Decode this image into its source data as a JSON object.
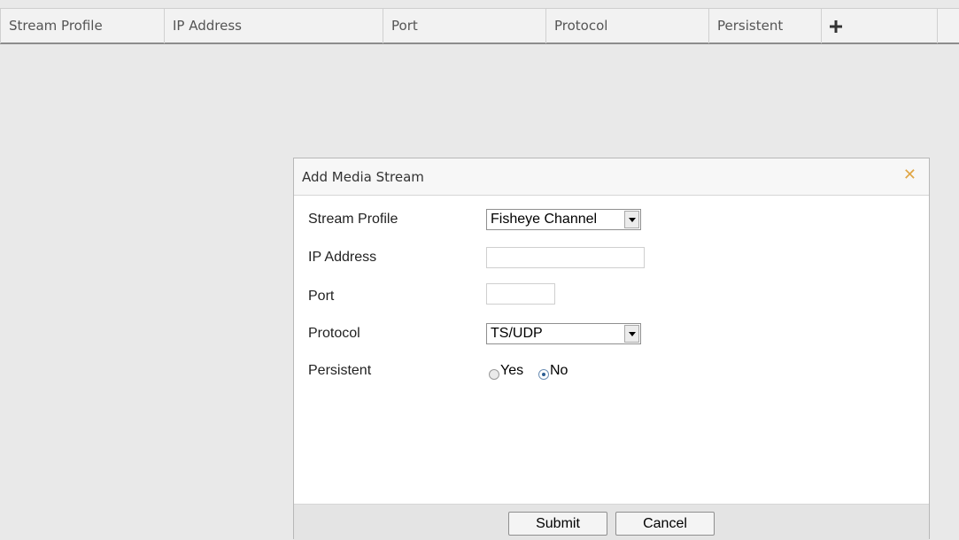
{
  "table": {
    "columns": [
      "Stream Profile",
      "IP Address",
      "Port",
      "Protocol",
      "Persistent"
    ],
    "add_icon": "plus-icon"
  },
  "dialog": {
    "title": "Add Media Stream",
    "close_icon": "close-icon",
    "fields": {
      "stream_profile": {
        "label": "Stream Profile",
        "value": "Fisheye Channel"
      },
      "ip_address": {
        "label": "IP Address",
        "value": ""
      },
      "port": {
        "label": "Port",
        "value": ""
      },
      "protocol": {
        "label": "Protocol",
        "value": "TS/UDP"
      },
      "persistent": {
        "label": "Persistent",
        "options": [
          "Yes",
          "No"
        ],
        "selected": "No"
      }
    },
    "buttons": {
      "submit": "Submit",
      "cancel": "Cancel"
    }
  }
}
